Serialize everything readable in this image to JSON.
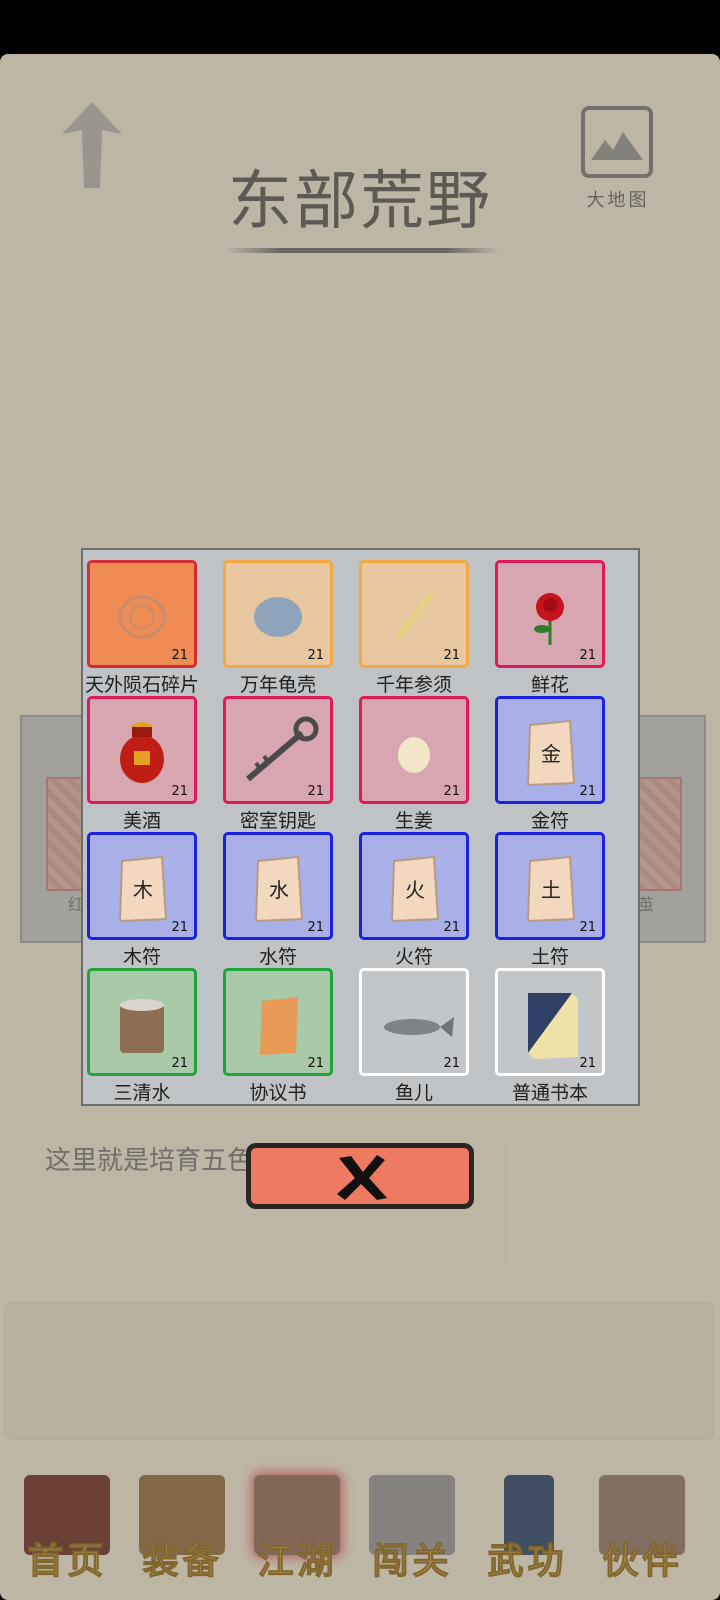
{
  "header": {
    "region_title": "东部荒野",
    "map_button_label": "大地图"
  },
  "side_panels": {
    "left_label": "红",
    "right_label": "茧"
  },
  "story": {
    "visible_text": "这里就是培育五色"
  },
  "inventory_popup": {
    "items": [
      {
        "name": "天外陨石碎片",
        "count": "21",
        "rarity_color": "#ef8c55",
        "border_color": "#d62a34",
        "icon": "meteorite-fragment-icon"
      },
      {
        "name": "万年龟壳",
        "count": "21",
        "rarity_color": "#e8c7a0",
        "border_color": "#f2a840",
        "icon": "turtle-shell-icon"
      },
      {
        "name": "千年参须",
        "count": "21",
        "rarity_color": "#e8c7a0",
        "border_color": "#f2a840",
        "icon": "ginseng-icon"
      },
      {
        "name": "鲜花",
        "count": "21",
        "rarity_color": "#d7a6b1",
        "border_color": "#e0195a",
        "icon": "rose-icon"
      },
      {
        "name": "美酒",
        "count": "21",
        "rarity_color": "#d7a6b1",
        "border_color": "#e0195a",
        "icon": "wine-jar-icon"
      },
      {
        "name": "密室钥匙",
        "count": "21",
        "rarity_color": "#d7a6b1",
        "border_color": "#e0195a",
        "icon": "key-icon"
      },
      {
        "name": "生姜",
        "count": "21",
        "rarity_color": "#d7a6b1",
        "border_color": "#e0195a",
        "icon": "ginger-icon"
      },
      {
        "name": "金符",
        "count": "21",
        "rarity_color": "#a9b0e8",
        "border_color": "#1b1fe0",
        "icon": "talisman-icon",
        "glyph": "金"
      },
      {
        "name": "木符",
        "count": "21",
        "rarity_color": "#a9b0e8",
        "border_color": "#1b1fe0",
        "icon": "talisman-icon",
        "glyph": "木"
      },
      {
        "name": "水符",
        "count": "21",
        "rarity_color": "#a9b0e8",
        "border_color": "#1b1fe0",
        "icon": "talisman-icon",
        "glyph": "水"
      },
      {
        "name": "火符",
        "count": "21",
        "rarity_color": "#a9b0e8",
        "border_color": "#1b1fe0",
        "icon": "talisman-icon",
        "glyph": "火"
      },
      {
        "name": "土符",
        "count": "21",
        "rarity_color": "#a9b0e8",
        "border_color": "#1b1fe0",
        "icon": "talisman-icon",
        "glyph": "土"
      },
      {
        "name": "三清水",
        "count": "21",
        "rarity_color": "#a9c9a8",
        "border_color": "#21a33a",
        "icon": "water-bucket-icon"
      },
      {
        "name": "协议书",
        "count": "21",
        "rarity_color": "#a9c9a8",
        "border_color": "#21a33a",
        "icon": "agreement-scroll-icon"
      },
      {
        "name": "鱼儿",
        "count": "21",
        "rarity_color": "#c3c6c9",
        "border_color": "#ffffff",
        "icon": "fish-icon"
      },
      {
        "name": "普通书本",
        "count": "21",
        "rarity_color": "#c3c6c9",
        "border_color": "#ffffff",
        "icon": "book-icon"
      }
    ]
  },
  "close_button": {
    "icon": "close-x-icon"
  },
  "bottom_nav": {
    "items": [
      {
        "label": "首页",
        "icon": "home-building-icon"
      },
      {
        "label": "装备",
        "icon": "armor-icon"
      },
      {
        "label": "江湖",
        "icon": "world-scroll-icon"
      },
      {
        "label": "闯关",
        "icon": "crossed-swords-icon"
      },
      {
        "label": "武功",
        "icon": "martial-book-icon"
      },
      {
        "label": "伙伴",
        "icon": "companions-icon"
      }
    ]
  }
}
